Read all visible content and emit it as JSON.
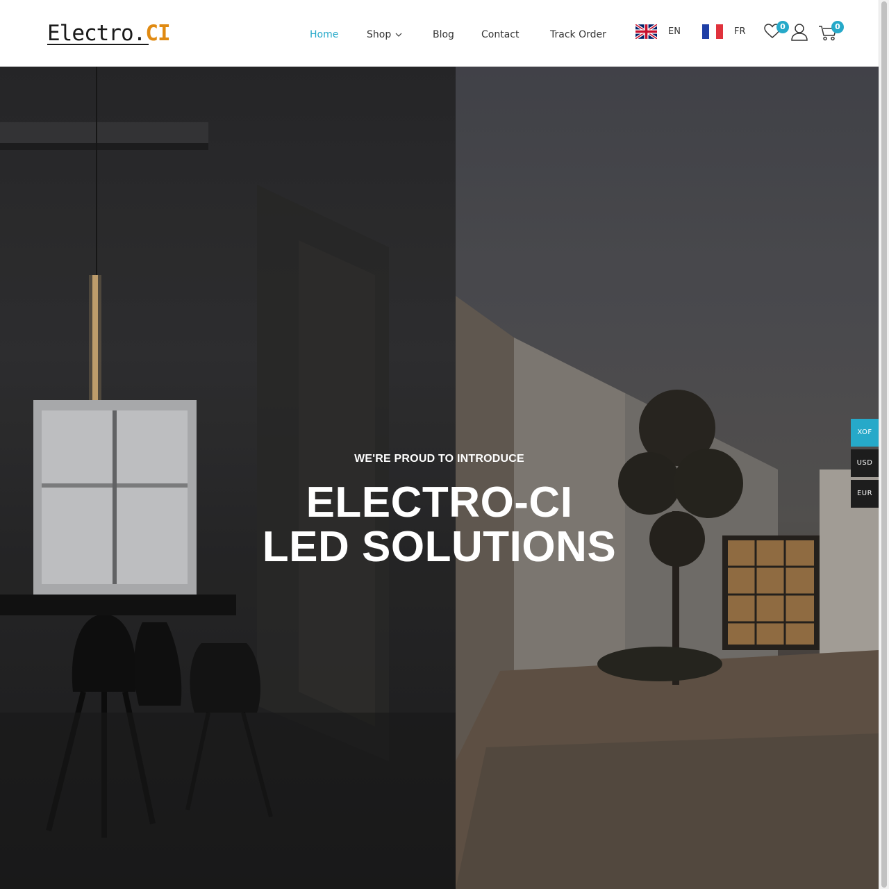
{
  "header": {
    "logo": {
      "main": "Electro",
      "dot": ".",
      "accent": "CI"
    },
    "nav": [
      {
        "label": "Home",
        "active": true
      },
      {
        "label": "Shop",
        "active": false,
        "has_dropdown": true
      },
      {
        "label": "Blog",
        "active": false
      },
      {
        "label": "Contact",
        "active": false
      },
      {
        "label": "Track Order",
        "active": false
      }
    ],
    "languages": [
      {
        "code": "EN",
        "flag": "uk-flag-icon"
      },
      {
        "code": "FR",
        "flag": "france-flag-icon"
      }
    ],
    "wishlist": {
      "icon": "heart-icon",
      "count": "0"
    },
    "account": {
      "icon": "user-icon"
    },
    "cart": {
      "icon": "cart-icon",
      "count": "0"
    }
  },
  "hero": {
    "overline": "WE'RE PROUD TO INTRODUCE",
    "title_line1": "ELECTRO-CI",
    "title_line2": "LED SOLUTIONS"
  },
  "currency": {
    "options": [
      "XOF",
      "USD",
      "EUR"
    ],
    "selected": "XOF"
  },
  "colors": {
    "accent": "#26a9c9",
    "logo_accent": "#e08a12",
    "currency_bg": "#1d1d1d"
  }
}
